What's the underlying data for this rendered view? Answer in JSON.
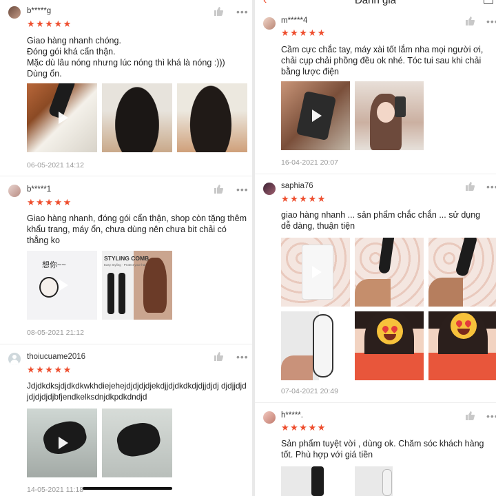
{
  "header": {
    "title": "Đánh giá"
  },
  "left": {
    "reviews": [
      {
        "username": "b*****g",
        "stars": "★★★★★",
        "text": "Giao hàng nhanh chóng.\nĐóng gói khá cẩn thận.\nMặc dù lâu nóng nhưng lúc nóng thì khá là nóng :)))\nDùng ổn.",
        "date": "06-05-2021 14:12"
      },
      {
        "username": "b*****1",
        "stars": "★★★★★",
        "text": "Giao hàng nhanh, đóng gói cẩn thận, shop còn tặng thêm khẩu trang, máy ổn, chưa dùng nên chưa bit chải có thẳng ko",
        "date": "08-05-2021 21:12"
      },
      {
        "username": "thoiucuame2016",
        "stars": "★★★★★",
        "text": "Jdjdkdksjdjdkdkwkhdiejehejdjdjdjdjekdjjdjdkdkdjdjjdjdj djdjjdjdjdjdjdjdjbfjendkelksdnjdkpdkdndjd",
        "date": "14-05-2021 11:18"
      }
    ],
    "sticker_text": "想你~~",
    "styling_comb": {
      "title": "STYLING COMB",
      "subtitle": "Easy Styling · Protect your hair"
    }
  },
  "right": {
    "reviews": [
      {
        "username": "m*****4",
        "stars": "★★★★★",
        "text": "Cầm cực chắc tay, máy xài tốt lắm nha mọi người ơi, chải cụp chải phồng đều ok nhé. Tóc tui sau khi chải bằng lược điện",
        "date": "16-04-2021 20:07"
      },
      {
        "username": "saphia76",
        "stars": "★★★★★",
        "text": "giao hàng nhanh ... sản phẩm chắc chắn ... sử dụng dễ dàng, thuận tiện",
        "date": "07-04-2021 20:49"
      },
      {
        "username": "h*****.",
        "stars": "★★★★★",
        "text": "Sản phẩm tuyệt vời , dùng ok. Chăm sóc khách hàng tốt. Phù hợp với giá tiền",
        "date": ""
      }
    ]
  },
  "icons": {
    "like": "thumbs-up-icon",
    "more": "more-icon",
    "play": "play-icon"
  },
  "colors": {
    "star": "#ee4d2d",
    "muted": "#999999"
  }
}
